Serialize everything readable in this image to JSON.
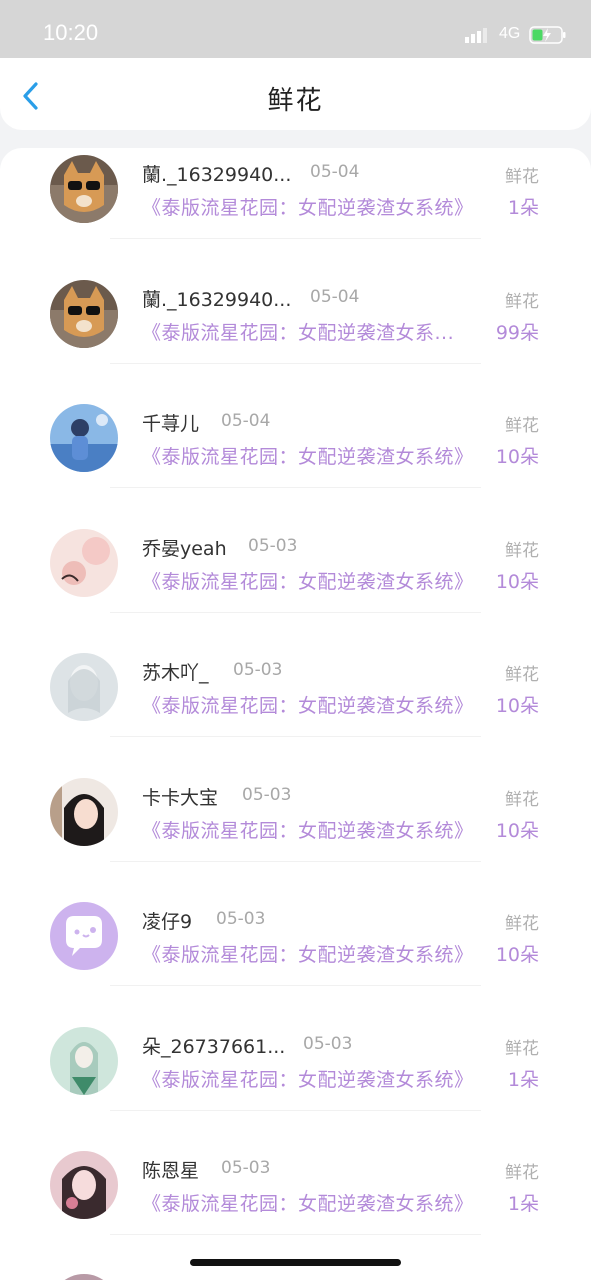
{
  "status_bar": {
    "time": "10:20",
    "network": "4G"
  },
  "header": {
    "title": "鲜花"
  },
  "rows": [
    {
      "name": "蘭._16329940...",
      "date": "05-04",
      "gift": "鲜花",
      "book": "《泰版流星花园：女配逆袭渣女系统》",
      "count": "1朵"
    },
    {
      "name": "蘭._16329940...",
      "date": "05-04",
      "gift": "鲜花",
      "book": "《泰版流星花园：女配逆袭渣女系...",
      "count": "99朵"
    },
    {
      "name": "千荨儿",
      "date": "05-04",
      "gift": "鲜花",
      "book": "《泰版流星花园：女配逆袭渣女系统》",
      "count": "10朵"
    },
    {
      "name": "乔晏yeah",
      "date": "05-03",
      "gift": "鲜花",
      "book": "《泰版流星花园：女配逆袭渣女系统》",
      "count": "10朵"
    },
    {
      "name": "苏木吖_",
      "date": "05-03",
      "gift": "鲜花",
      "book": "《泰版流星花园：女配逆袭渣女系统》",
      "count": "10朵"
    },
    {
      "name": "卡卡大宝",
      "date": "05-03",
      "gift": "鲜花",
      "book": "《泰版流星花园：女配逆袭渣女系统》",
      "count": "10朵"
    },
    {
      "name": "凌仔9",
      "date": "05-03",
      "gift": "鲜花",
      "book": "《泰版流星花园：女配逆袭渣女系统》",
      "count": "10朵"
    },
    {
      "name": "朵_26737661...",
      "date": "05-03",
      "gift": "鲜花",
      "book": "《泰版流星花园：女配逆袭渣女系统》",
      "count": "1朵"
    },
    {
      "name": "陈恩星",
      "date": "05-03",
      "gift": "鲜花",
      "book": "《泰版流星花园：女配逆袭渣女系统》",
      "count": "1朵"
    }
  ]
}
